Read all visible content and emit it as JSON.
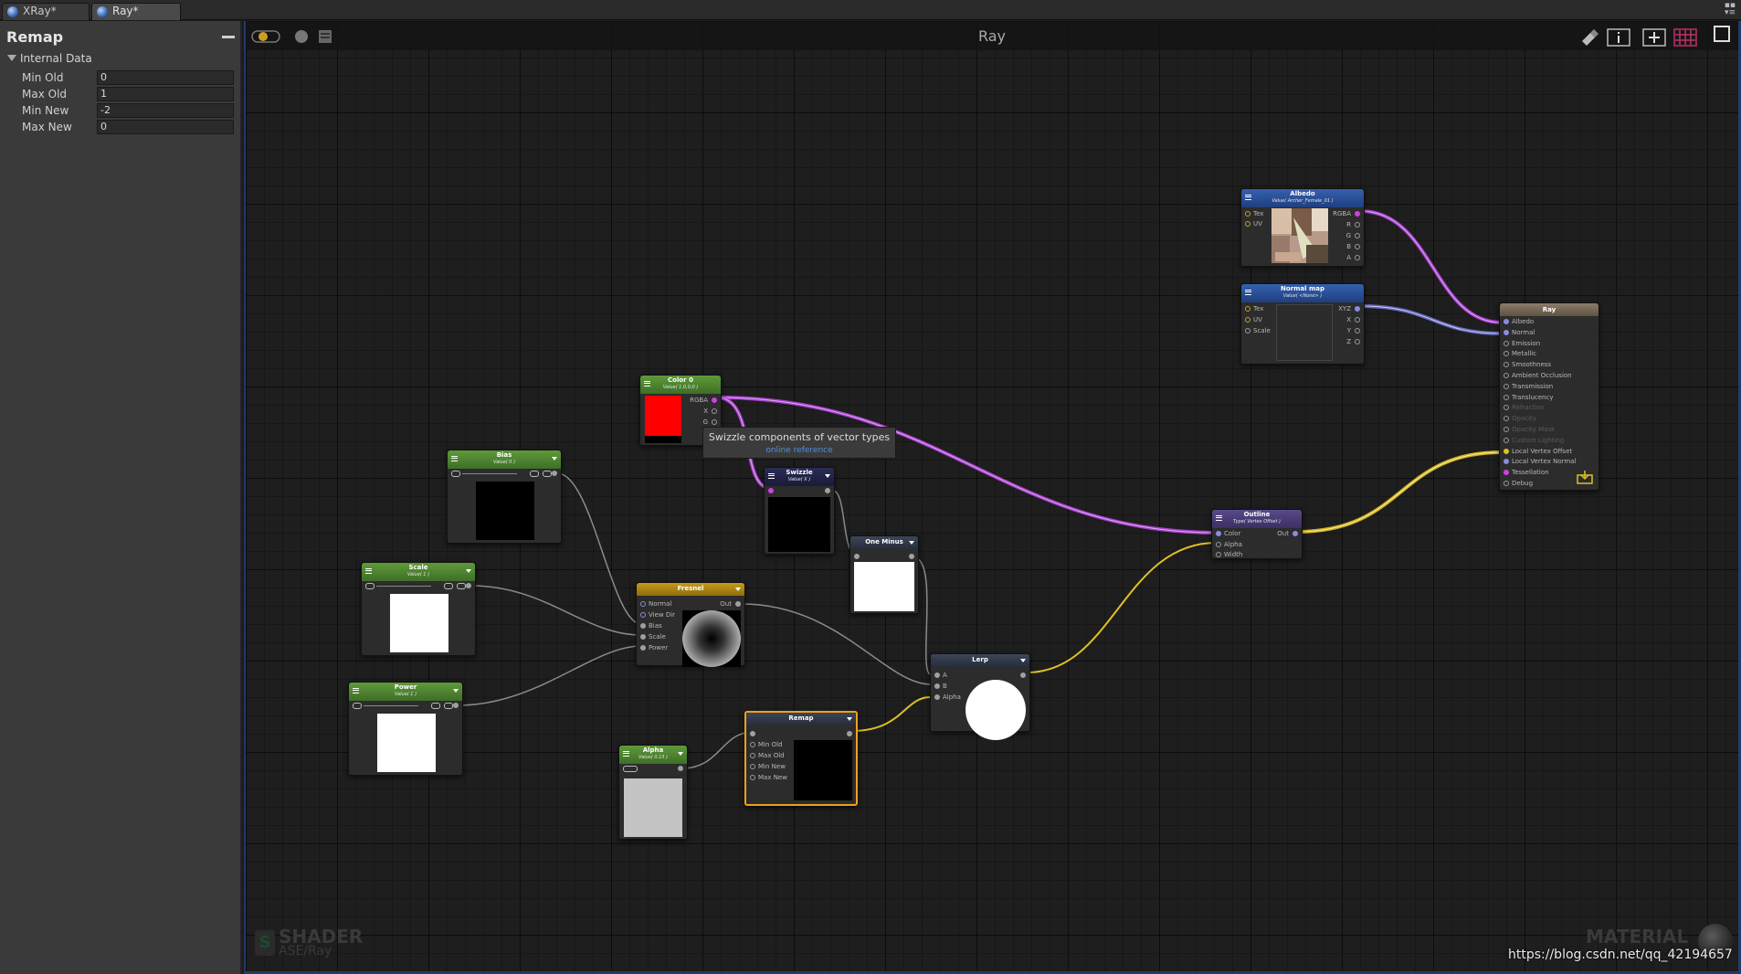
{
  "tabs": [
    {
      "label": "XRay*",
      "active": false
    },
    {
      "label": "Ray*",
      "active": true
    }
  ],
  "panel": {
    "title": "Remap",
    "section": "Internal Data",
    "properties": [
      {
        "label": "Min Old",
        "value": "0"
      },
      {
        "label": "Max Old",
        "value": "1"
      },
      {
        "label": "Min New",
        "value": "-2"
      },
      {
        "label": "Max New",
        "value": "0"
      }
    ]
  },
  "canvas": {
    "title": "Ray",
    "watermark_shader": "SHADER",
    "watermark_shader_path": "ASE/Ray",
    "watermark_material": "MATERIAL",
    "url": "https://blog.csdn.net/qq_42194657"
  },
  "tooltip": {
    "text": "Swizzle components of vector types",
    "link": "online reference"
  },
  "nodes": {
    "albedo": {
      "title": "Albedo",
      "sub": "Value( Archer_Female_01 )",
      "inputs": [
        "Tex",
        "UV"
      ],
      "outputs": [
        "RGBA",
        "R",
        "G",
        "B",
        "A"
      ]
    },
    "normalmap": {
      "title": "Normal map",
      "sub": "Value( <None> )",
      "inputs": [
        "Tex",
        "UV",
        "Scale"
      ],
      "outputs": [
        "XYZ",
        "X",
        "Y",
        "Z"
      ]
    },
    "ray": {
      "title": "Ray",
      "inputs": [
        "Albedo",
        "Normal",
        "Emission",
        "Metallic",
        "Smoothness",
        "Ambient Occlusion",
        "Transmission",
        "Translucency",
        "Refraction",
        "Opacity",
        "Opacity Mask",
        "Custom Lighting",
        "Local Vertex Offset",
        "Local Vertex Normal",
        "Tessellation",
        "Debug"
      ]
    },
    "color0": {
      "title": "Color 0",
      "sub": "Value( 1,0,0,0 )",
      "outputs": [
        "RGBA",
        "X",
        "G"
      ]
    },
    "bias": {
      "title": "Bias",
      "sub": "Value( 0 )"
    },
    "scale": {
      "title": "Scale",
      "sub": "Value( 1 )"
    },
    "power": {
      "title": "Power",
      "sub": "Value( 1 )"
    },
    "swizzle": {
      "title": "Swizzle",
      "sub": "Value( X )"
    },
    "oneminus": {
      "title": "One Minus"
    },
    "fresnel": {
      "title": "Fresnel",
      "inputs": [
        "Normal",
        "View Dir",
        "Bias",
        "Scale",
        "Power"
      ],
      "outputs": [
        "Out"
      ]
    },
    "outline": {
      "title": "Outline",
      "sub": "Type( Vertex Offset )",
      "inputs": [
        "Color",
        "Alpha",
        "Width"
      ],
      "outputs": [
        "Out"
      ]
    },
    "lerp": {
      "title": "Lerp",
      "inputs": [
        "A",
        "B",
        "Alpha"
      ]
    },
    "remap": {
      "title": "Remap",
      "inputs": [
        "Min Old",
        "Max Old",
        "Min New",
        "Max New"
      ]
    },
    "alpha": {
      "title": "Alpha",
      "sub": "Value( 0.13 )"
    }
  },
  "colors": {
    "wire_purple": "#b048d8",
    "wire_yellow": "#e0c020",
    "wire_blue": "#8a8ce0",
    "wire_gray": "#8a8a8a",
    "selection": "#f0a020"
  },
  "icons": [
    "live-preview-icon",
    "sphere-preview-icon",
    "library-icon",
    "clean-icon",
    "info-icon",
    "focus-icon",
    "grid-icon",
    "maximize-icon"
  ]
}
